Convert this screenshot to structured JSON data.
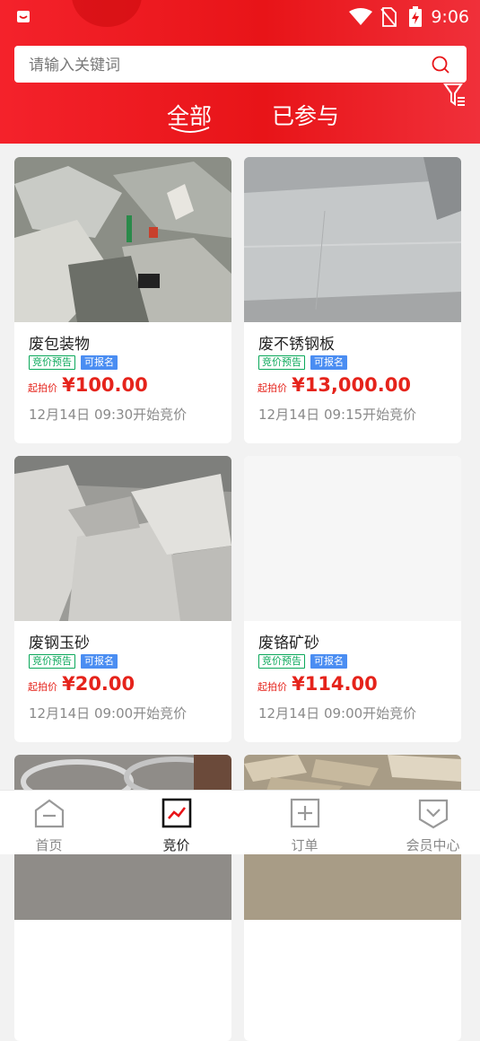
{
  "status": {
    "time": "9:06"
  },
  "search": {
    "placeholder": "请输入关键词"
  },
  "tabs": [
    {
      "label": "全部",
      "active": true
    },
    {
      "label": "已参与",
      "active": false
    }
  ],
  "cards": [
    {
      "title": "废包装物",
      "badge_preview": "竞价预告",
      "badge_signup": "可报名",
      "price_label": "起拍价",
      "price": "¥100.00",
      "time": "12月14日 09:30开始竞价",
      "photo": "trash-pile"
    },
    {
      "title": "废不锈钢板",
      "badge_preview": "竞价预告",
      "badge_signup": "可报名",
      "price_label": "起拍价",
      "price": "¥13,000.00",
      "time": "12月14日 09:15开始竞价",
      "photo": "steel-plates"
    },
    {
      "title": "废钢玉砂",
      "badge_preview": "竞价预告",
      "badge_signup": "可报名",
      "price_label": "起拍价",
      "price": "¥20.00",
      "time": "12月14日 09:00开始竞价",
      "photo": "sand-bags"
    },
    {
      "title": "废铬矿砂",
      "badge_preview": "竞价预告",
      "badge_signup": "可报名",
      "price_label": "起拍价",
      "price": "¥114.00",
      "time": "12月14日 09:00开始竞价",
      "photo": "blank"
    },
    {
      "photo": "metal-coils"
    },
    {
      "photo": "wood-scraps"
    }
  ],
  "nav": [
    {
      "label": "首页",
      "icon": "home-icon",
      "active": false
    },
    {
      "label": "竞价",
      "icon": "chart-icon",
      "active": true
    },
    {
      "label": "订单",
      "icon": "order-icon",
      "active": false
    },
    {
      "label": "会员中心",
      "icon": "member-icon",
      "active": false
    }
  ],
  "colors": {
    "brand_red": "#e81418",
    "badge_green": "#0aa85a",
    "badge_blue": "#4a8df2",
    "price_red": "#e5231b"
  }
}
